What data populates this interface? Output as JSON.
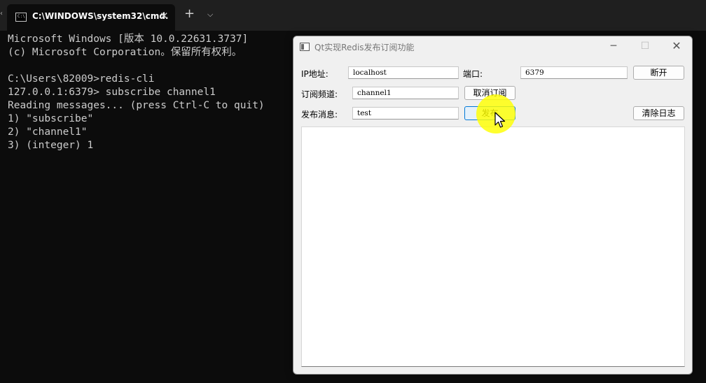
{
  "terminal": {
    "tab_title": "C:\\WINDOWS\\system32\\cmd.",
    "tab_icon_text": "C:\\.",
    "lines": [
      "Microsoft Windows [版本 10.0.22631.3737]",
      "(c) Microsoft Corporation。保留所有权利。",
      "",
      "C:\\Users\\82009>redis-cli",
      "127.0.0.1:6379> subscribe channel1",
      "Reading messages... (press Ctrl-C to quit)",
      "1) \"subscribe\"",
      "2) \"channel1\"",
      "3) (integer) 1"
    ]
  },
  "qt": {
    "title": "Qt实现Redis发布订阅功能",
    "ip_label": "IP地址:",
    "ip_value": "localhost",
    "port_label": "端口:",
    "port_value": "6379",
    "disconnect_label": "断开",
    "channel_label": "订阅频道:",
    "channel_value": "channel1",
    "unsubscribe_label": "取消订阅",
    "message_label": "发布消息:",
    "message_value": "test",
    "publish_label": "发布",
    "clear_log_label": "清除日志"
  }
}
